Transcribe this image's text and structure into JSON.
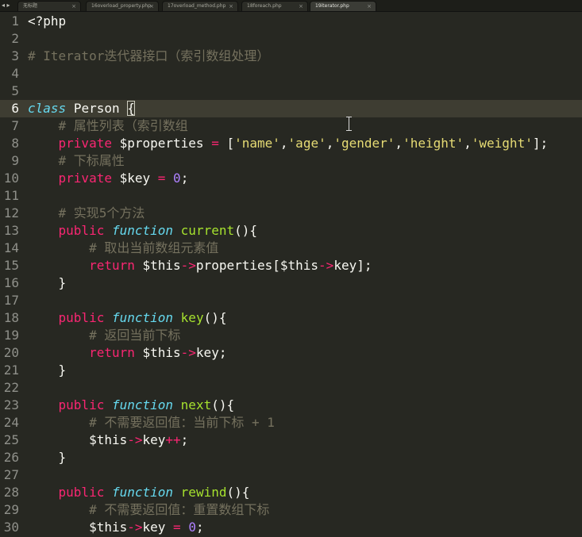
{
  "tab_bar": {
    "nav_arrows": "◂ ▸",
    "tabs": [
      {
        "label": "无标题",
        "active": false
      },
      {
        "label": "16overload_property.php",
        "active": false
      },
      {
        "label": "17overload_method.php",
        "active": false
      },
      {
        "label": "18foreach.php",
        "active": false
      },
      {
        "label": "19iterator.php",
        "active": true
      }
    ],
    "close_glyph": "×"
  },
  "colors": {
    "background": "#272822",
    "default": "#f8f8f2",
    "keyword": "#f92672",
    "storage": "#66d9ef",
    "function": "#a6e22e",
    "string": "#e6db74",
    "number": "#ae81ff",
    "comment": "#75715e",
    "gutter": "#8f908a",
    "active_line": "#3e3d32"
  },
  "editor": {
    "active_line_number": 6,
    "lines": [
      {
        "n": "1",
        "tokens": [
          {
            "t": "<?php",
            "c": "default"
          }
        ]
      },
      {
        "n": "2",
        "tokens": []
      },
      {
        "n": "3",
        "tokens": [
          {
            "t": "# Iterator迭代器接口（索引数组处理）",
            "c": "comment"
          }
        ]
      },
      {
        "n": "4",
        "tokens": []
      },
      {
        "n": "5",
        "tokens": []
      },
      {
        "n": "6",
        "tokens": [
          {
            "t": "class",
            "c": "storage-italic"
          },
          {
            "t": " ",
            "c": "default"
          },
          {
            "t": "Person",
            "c": "default"
          },
          {
            "t": " ",
            "c": "default"
          },
          {
            "t": "{",
            "c": "bracket"
          }
        ]
      },
      {
        "n": "7",
        "tokens": [
          {
            "t": "    # 属性列表（索引数组",
            "c": "comment"
          }
        ]
      },
      {
        "n": "8",
        "tokens": [
          {
            "t": "    ",
            "c": "default"
          },
          {
            "t": "private",
            "c": "keyword"
          },
          {
            "t": " $properties ",
            "c": "default"
          },
          {
            "t": "=",
            "c": "keyword"
          },
          {
            "t": " [",
            "c": "default"
          },
          {
            "t": "'name'",
            "c": "string"
          },
          {
            "t": ",",
            "c": "default"
          },
          {
            "t": "'age'",
            "c": "string"
          },
          {
            "t": ",",
            "c": "default"
          },
          {
            "t": "'gender'",
            "c": "string"
          },
          {
            "t": ",",
            "c": "default"
          },
          {
            "t": "'height'",
            "c": "string"
          },
          {
            "t": ",",
            "c": "default"
          },
          {
            "t": "'weight'",
            "c": "string"
          },
          {
            "t": "];",
            "c": "default"
          }
        ]
      },
      {
        "n": "9",
        "tokens": [
          {
            "t": "    # 下标属性",
            "c": "comment"
          }
        ]
      },
      {
        "n": "10",
        "tokens": [
          {
            "t": "    ",
            "c": "default"
          },
          {
            "t": "private",
            "c": "keyword"
          },
          {
            "t": " $key ",
            "c": "default"
          },
          {
            "t": "=",
            "c": "keyword"
          },
          {
            "t": " ",
            "c": "default"
          },
          {
            "t": "0",
            "c": "number"
          },
          {
            "t": ";",
            "c": "default"
          }
        ]
      },
      {
        "n": "11",
        "tokens": []
      },
      {
        "n": "12",
        "tokens": [
          {
            "t": "    # 实现5个方法",
            "c": "comment"
          }
        ]
      },
      {
        "n": "13",
        "tokens": [
          {
            "t": "    ",
            "c": "default"
          },
          {
            "t": "public",
            "c": "keyword"
          },
          {
            "t": " ",
            "c": "default"
          },
          {
            "t": "function",
            "c": "storage-italic"
          },
          {
            "t": " ",
            "c": "default"
          },
          {
            "t": "current",
            "c": "function"
          },
          {
            "t": "(){",
            "c": "default"
          }
        ]
      },
      {
        "n": "14",
        "tokens": [
          {
            "t": "        # 取出当前数组元素值",
            "c": "comment"
          }
        ]
      },
      {
        "n": "15",
        "tokens": [
          {
            "t": "        ",
            "c": "default"
          },
          {
            "t": "return",
            "c": "keyword"
          },
          {
            "t": " $this",
            "c": "default"
          },
          {
            "t": "->",
            "c": "keyword"
          },
          {
            "t": "properties[$this",
            "c": "default"
          },
          {
            "t": "->",
            "c": "keyword"
          },
          {
            "t": "key];",
            "c": "default"
          }
        ]
      },
      {
        "n": "16",
        "tokens": [
          {
            "t": "    }",
            "c": "default"
          }
        ]
      },
      {
        "n": "17",
        "tokens": []
      },
      {
        "n": "18",
        "tokens": [
          {
            "t": "    ",
            "c": "default"
          },
          {
            "t": "public",
            "c": "keyword"
          },
          {
            "t": " ",
            "c": "default"
          },
          {
            "t": "function",
            "c": "storage-italic"
          },
          {
            "t": " ",
            "c": "default"
          },
          {
            "t": "key",
            "c": "function"
          },
          {
            "t": "(){",
            "c": "default"
          }
        ]
      },
      {
        "n": "19",
        "tokens": [
          {
            "t": "        # 返回当前下标",
            "c": "comment"
          }
        ]
      },
      {
        "n": "20",
        "tokens": [
          {
            "t": "        ",
            "c": "default"
          },
          {
            "t": "return",
            "c": "keyword"
          },
          {
            "t": " $this",
            "c": "default"
          },
          {
            "t": "->",
            "c": "keyword"
          },
          {
            "t": "key;",
            "c": "default"
          }
        ]
      },
      {
        "n": "21",
        "tokens": [
          {
            "t": "    }",
            "c": "default"
          }
        ]
      },
      {
        "n": "22",
        "tokens": []
      },
      {
        "n": "23",
        "tokens": [
          {
            "t": "    ",
            "c": "default"
          },
          {
            "t": "public",
            "c": "keyword"
          },
          {
            "t": " ",
            "c": "default"
          },
          {
            "t": "function",
            "c": "storage-italic"
          },
          {
            "t": " ",
            "c": "default"
          },
          {
            "t": "next",
            "c": "function"
          },
          {
            "t": "(){",
            "c": "default"
          }
        ]
      },
      {
        "n": "24",
        "tokens": [
          {
            "t": "        # 不需要返回值：当前下标 + 1",
            "c": "comment"
          }
        ]
      },
      {
        "n": "25",
        "tokens": [
          {
            "t": "        $this",
            "c": "default"
          },
          {
            "t": "->",
            "c": "keyword"
          },
          {
            "t": "key",
            "c": "default"
          },
          {
            "t": "++",
            "c": "keyword"
          },
          {
            "t": ";",
            "c": "default"
          }
        ]
      },
      {
        "n": "26",
        "tokens": [
          {
            "t": "    }",
            "c": "default"
          }
        ]
      },
      {
        "n": "27",
        "tokens": []
      },
      {
        "n": "28",
        "tokens": [
          {
            "t": "    ",
            "c": "default"
          },
          {
            "t": "public",
            "c": "keyword"
          },
          {
            "t": " ",
            "c": "default"
          },
          {
            "t": "function",
            "c": "storage-italic"
          },
          {
            "t": " ",
            "c": "default"
          },
          {
            "t": "rewind",
            "c": "function"
          },
          {
            "t": "(){",
            "c": "default"
          }
        ]
      },
      {
        "n": "29",
        "tokens": [
          {
            "t": "        # 不需要返回值：重置数组下标",
            "c": "comment"
          }
        ]
      },
      {
        "n": "30",
        "tokens": [
          {
            "t": "        $this",
            "c": "default"
          },
          {
            "t": "->",
            "c": "keyword"
          },
          {
            "t": "key ",
            "c": "default"
          },
          {
            "t": "=",
            "c": "keyword"
          },
          {
            "t": " ",
            "c": "default"
          },
          {
            "t": "0",
            "c": "number"
          },
          {
            "t": ";",
            "c": "default"
          }
        ]
      }
    ]
  }
}
